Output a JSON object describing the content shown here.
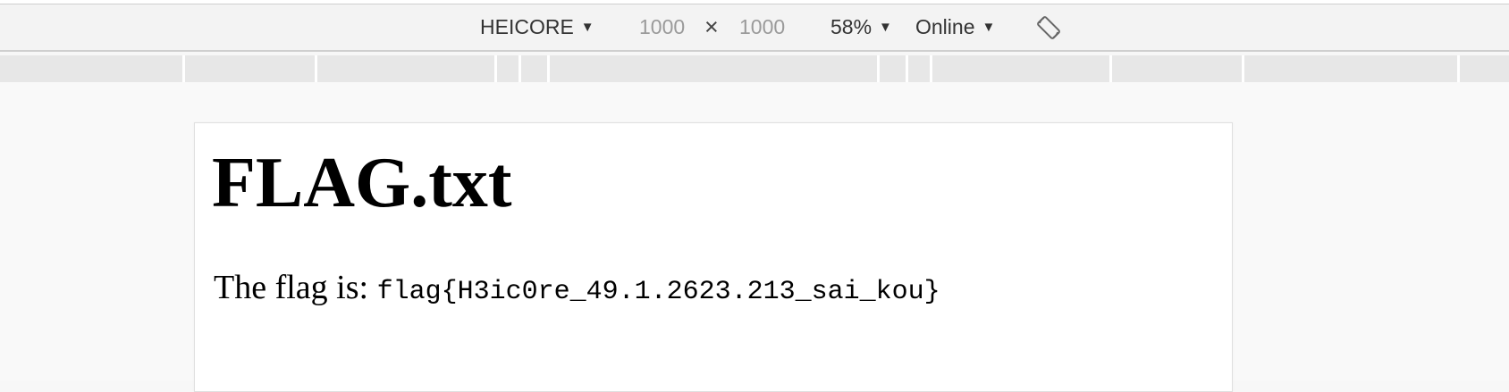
{
  "toolbar": {
    "device": "HEICORE",
    "width": "1000",
    "times": "×",
    "height": "1000",
    "zoom": "58%",
    "network": "Online",
    "caret": "▼",
    "rotate_icon": "rotate-device-icon"
  },
  "document": {
    "title": "FLAG.txt",
    "flag_prefix": "The flag is: ",
    "flag_value": "flag{H3ic0re_49.1.2623.213_sai_kou}"
  }
}
